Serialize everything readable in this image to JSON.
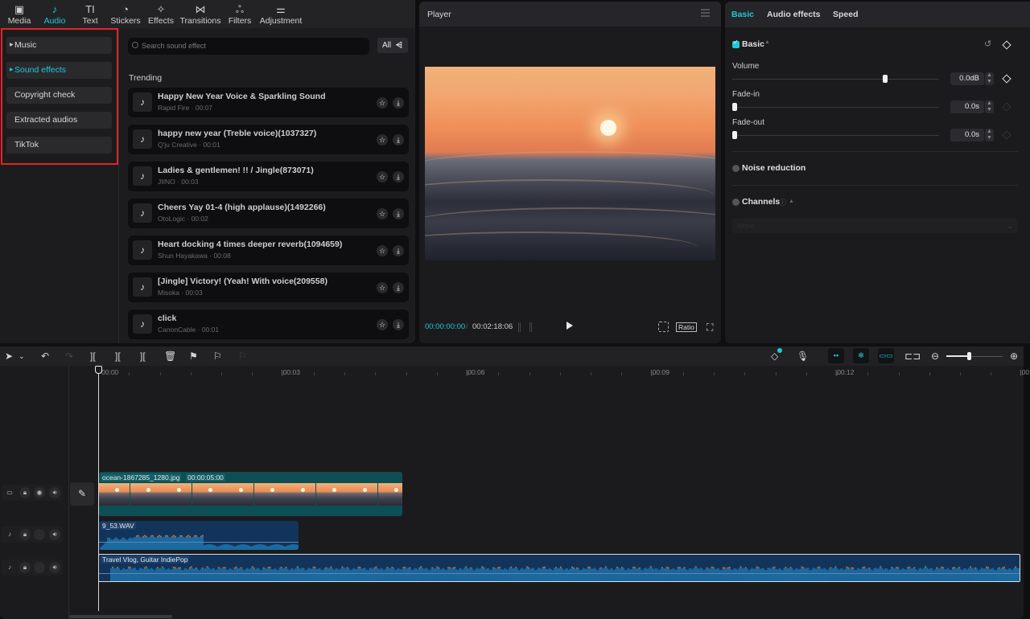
{
  "top_nav": [
    {
      "label": "Media",
      "icon": "media-icon",
      "glyph": "▣"
    },
    {
      "label": "Audio",
      "icon": "audio-icon",
      "glyph": "♪",
      "active": true
    },
    {
      "label": "Text",
      "icon": "text-icon",
      "glyph": "TI"
    },
    {
      "label": "Stickers",
      "icon": "stickers-icon",
      "glyph": "◔"
    },
    {
      "label": "Effects",
      "icon": "effects-icon",
      "glyph": "✧"
    },
    {
      "label": "Transitions",
      "icon": "transitions-icon",
      "glyph": "⋈"
    },
    {
      "label": "Filters",
      "icon": "filters-icon",
      "glyph": "ஃ"
    },
    {
      "label": "Adjustment",
      "icon": "adjustment-icon",
      "glyph": "⚌"
    }
  ],
  "categories": [
    {
      "label": "Music",
      "expandable": true
    },
    {
      "label": "Sound effects",
      "expandable": true,
      "active": true
    },
    {
      "label": "Copyright check"
    },
    {
      "label": "Extracted audios"
    },
    {
      "label": "TikTok"
    }
  ],
  "search": {
    "placeholder": "Search sound effect",
    "filter_label": "All"
  },
  "section_title": "Trending",
  "sounds": [
    {
      "title": "Happy New Year Voice & Sparkling Sound",
      "meta": "Rapid Fire · 00:07"
    },
    {
      "title": "happy new year (Treble voice)(1037327)",
      "meta": "Q'ju Creative · 00:01"
    },
    {
      "title": "Ladies & gentlemen! !! / Jingle(873071)",
      "meta": "JIINO · 00:03"
    },
    {
      "title": "Cheers Yay 01-4 (high applause)(1492266)",
      "meta": "OtoLogic · 00:02"
    },
    {
      "title": "Heart docking 4 times deeper reverb(1094659)",
      "meta": "Shun Hayakawa · 00:08"
    },
    {
      "title": "[Jingle] Victory! (Yeah! With voice(209558)",
      "meta": "Misoka · 00:03"
    },
    {
      "title": "click",
      "meta": "CanonCable · 00:01"
    }
  ],
  "player": {
    "title": "Player",
    "current_time": "00:00:00:00",
    "separator": "/",
    "total_time": "00:02:18:06",
    "ratio_label": "Ratio"
  },
  "right_panel": {
    "tabs": [
      {
        "label": "Basic",
        "active": true
      },
      {
        "label": "Audio effects"
      },
      {
        "label": "Speed"
      }
    ],
    "basic_section": "Basic",
    "volume": {
      "label": "Volume",
      "value": "0.0dB",
      "slider_fraction": 0.74
    },
    "fade_in": {
      "label": "Fade-in",
      "value": "0.0s",
      "slider_fraction": 0
    },
    "fade_out": {
      "label": "Fade-out",
      "value": "0.0s",
      "slider_fraction": 0
    },
    "noise_reduction": "Noise reduction",
    "channels": "Channels",
    "channels_value": "None"
  },
  "timeline": {
    "ruler": [
      {
        "label": "00:00",
        "sec": 0
      },
      {
        "label": "|00:03",
        "sec": 3
      },
      {
        "label": "|00:06",
        "sec": 6
      },
      {
        "label": "|00:09",
        "sec": 9
      },
      {
        "label": "|00:12",
        "sec": 12
      },
      {
        "label": "|00",
        "sec": 15
      }
    ],
    "zoom_fraction": 0.42,
    "video_clip": {
      "name": "ocean-1867285_1280.jpg",
      "duration": "00:00:05:00",
      "frames": 10
    },
    "audio_clips": [
      {
        "name": "9_53.WAV"
      },
      {
        "name": "Travel Vlog, Guitar IndiePop"
      }
    ]
  }
}
